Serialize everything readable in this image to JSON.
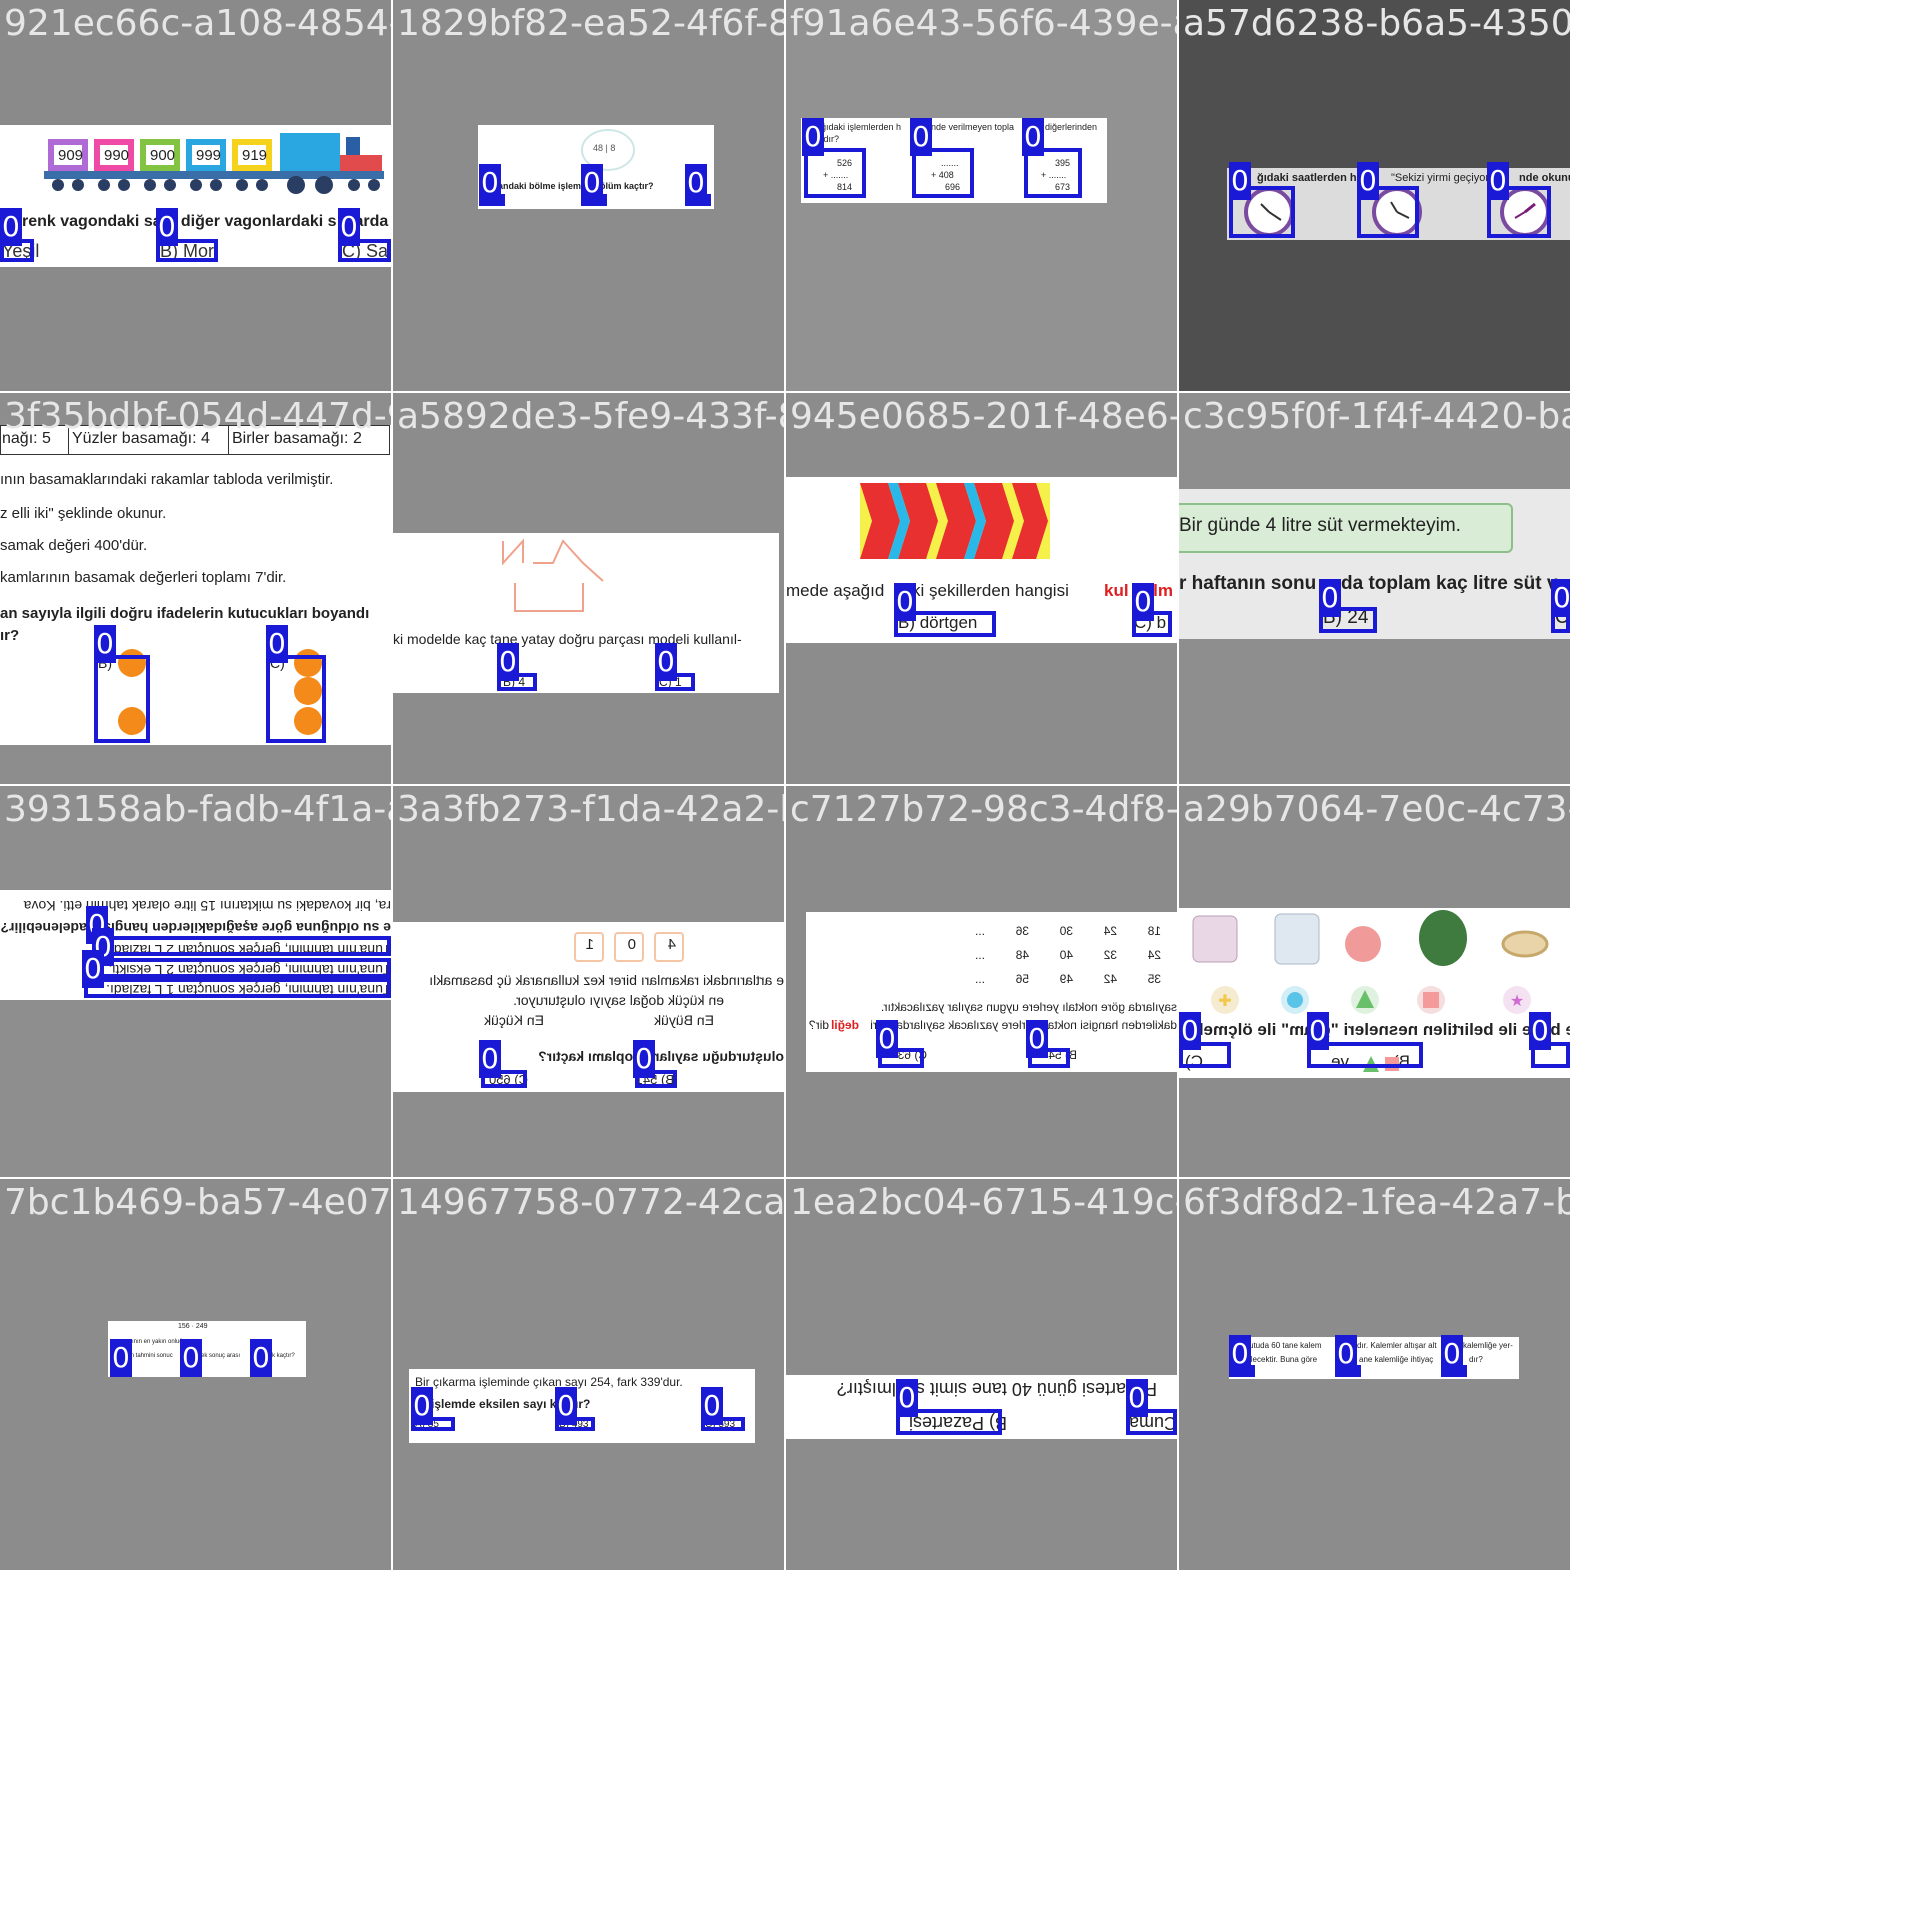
{
  "colors": {
    "title": "#e6e6e6",
    "annotation_box": "#1a1ad6",
    "annotation_label_bg": "#1a1ad6",
    "annotation_label_text": "#ffffff"
  },
  "annotation_label": "0",
  "tiles": [
    {
      "title": "921ec66c-a108-4854-8482-9ad2b8fc5a3c.jpg",
      "bg": "#8a8a8a",
      "text": {
        "q": "renk vagondaki sa",
        "q2": ", diğer vagonlardaki s",
        "q3": "larda",
        "wagons": [
          "909",
          "990",
          "900",
          "999",
          "919"
        ],
        "a": "Yeşil",
        "b": "B) Mor",
        "c": "C) Sarı"
      }
    },
    {
      "title": "1829bf82-ea52-4f6f-8214-3e791a3e4345.jpg",
      "bg": "#8c8c8c",
      "text": {
        "q": "andaki bölme işlemin",
        "q2": "ölüm kaçtır?",
        "div": "48 | 8"
      }
    },
    {
      "title": "f91a6e43-56f6-439e-ab83-3d57d0c2d65.jpg",
      "bg": "#929292",
      "text": {
        "q": "ğıdaki işlemlerden h",
        "q2": "inde verilmeyen topla",
        "q3": "diğerlerinden",
        "q4": "ıdır?",
        "a_top": "526",
        "a_plus": "+ .......",
        "a_res": "814",
        "b_top": ".......",
        "b_plus": "+ 408",
        "b_res": "696",
        "c_top": "395",
        "c_plus": "+ .......",
        "c_res": "673"
      }
    },
    {
      "title": "a57d6238-b6a5-4350-8cd5-e1.jpg",
      "bg": "#4f4f4f",
      "text": {
        "q": "ğıdaki saatlerden han",
        "q2": "\"Sekizi yirmi geçiyor.\"",
        "q3": "nde okunur?"
      }
    },
    {
      "title": "3f35bdbf-054d-447d-94fb-44158952465.jpg",
      "bg": "#8d8d8d",
      "text": {
        "c1": "nağı: 5",
        "c2": "Yüzler basamağı: 4",
        "c3": "Birler basamağı: 2",
        "l1": "ının basamaklarındaki rakamlar tabloda verilmiştir.",
        "l2": "z elli iki\" şeklinde okunur.",
        "l3": "samak değeri 400'dür.",
        "l4": "kamlarının basamak değerleri toplamı 7'dir.",
        "l5": "an sayıyla ilgili doğru ifadelerin kutucukları boyandı",
        "l6": "ır?",
        "b": "B)",
        "c": "C)"
      }
    },
    {
      "title": "a5892de3-5fe9-433f-83a6-a5fe5ad8e2c1.jpg",
      "bg": "#8c8c8c",
      "text": {
        "q": "ki modelde kaç tane yatay doğru parçası modeli kullanıl-",
        "b": "B) 4",
        "c": "C) 1"
      }
    },
    {
      "title": "945e0685-201f-48e6-b5e6-c8bd29542704.jpg",
      "bg": "#8c8c8c",
      "text": {
        "q": "mede aşağıd",
        "q2": "ki şekillerden hangisi ",
        "q3": "kul",
        "q4": "nılm",
        "b": "B) dörtgen",
        "c": "C) b"
      }
    },
    {
      "title": "c3c95f0f-1f4f-4420-ba85-c0.jpg",
      "bg": "#8e8e8e",
      "text": {
        "bubble": "Bir günde 4 litre süt vermekteyim.",
        "q": "r haftanın sonu",
        "q2": "da toplam kaç litre süt v",
        "b": "B) 24",
        "c": "C"
      }
    },
    {
      "title": "393158ab-fadb-4f1a-ae1a-e3a1cfb23e0b.jpg",
      "bg": "#8e8e8e",
      "text": {
        "q": "ra, bir kovadaki su miktarını 15 litre olarak tahmin etti. Kova",
        "q2": "e su olduğuna göre aşağıdakilerden hangisi ifadelenebilir?",
        "o1": "Tuna'nın tahmini, gerçek sonuçtan 2 L fazladı.",
        "o2": "Tuna'nın tahmini, gerçek sonuçtan 2 L eksikti.",
        "o3": "Tuna'nın tahmini, gerçek sonuçtan 1 L fazladı."
      }
    },
    {
      "title": "3a3fb273-f1da-42a2-bb3a-c7127b72985c.jpg",
      "bg": "#8d8d8d",
      "text": {
        "d1": "4",
        "d2": "0",
        "d3": "1",
        "q": "e artlarındaki rakamları birer kez kullanarak üç basamaklı",
        "q2": "en küçük doğal sayıyı oluşturuyor.",
        "l1": "En Büyük",
        "l2": "En Küçük",
        "q3": "oluşturduğu sayıların toplamı kaçtır?",
        "b": "B) 541",
        "c": "C) 650"
      }
    },
    {
      "title": "c7127b72-98c3-4df8-a626-8290766a7e2d.jpg",
      "bg": "#8b8b8b",
      "text": {
        "r1": [
          "18",
          "24",
          "30",
          "36",
          "..."
        ],
        "r2": [
          "24",
          "32",
          "40",
          "48",
          "..."
        ],
        "r3": [
          "35",
          "42",
          "49",
          "56",
          "..."
        ],
        "q": "sayılarda göre noktalı yerlere uygun sayılar yazılacaktır.",
        "q2": "dakilerden hangisi noktalı yerlere yazılacak sayılardan biri",
        "q3": "değil",
        "q4": "dir?",
        "b": "B) 54",
        "c": "C) 63"
      }
    },
    {
      "title": "a29b7064-7e0c-4c73-8230-1b.jpg",
      "bg": "#8c8c8c",
      "text": {
        "q": "se belle ile belirtilen nesneleri \"gram\" ile ölçmek o",
        "b": "B)",
        "b2": "ve",
        "c": "C)"
      }
    },
    {
      "title": "7bc1b469-ba57-4e07-a90e-d4a3e7f58de7.jpg",
      "bg": "#8c8c8c",
      "text": {
        "num": "156 · 249",
        "q": "sayısının en yakın onluğa y",
        "q2": "nin tahmini sonuc",
        "q3": "rçek sonuç arası",
        "q4": "rk kaçtır?"
      }
    },
    {
      "title": "14967758-0772-42ca-9ae5-4f5e2694f6b5.jpg",
      "bg": "#8c8c8c",
      "text": {
        "q": "Bir çıkarma işleminde çıkan sayı 254, fark 339'dur.",
        "q2": "işlemde eksilen sayı k",
        "q3": "ır?",
        "a": "A) 85",
        "b": "B) 493",
        "c": "C) 593"
      }
    },
    {
      "title": "1ea2bc04-6715-419c-9abe-7a6f30c92f5a.jpg",
      "bg": "#8c8c8c",
      "text": {
        "q": "Pazartesi günü 40 tane simit satılmıştır?",
        "b": "B) Pazartesi",
        "c": "Cuma"
      }
    },
    {
      "title": "6f3df8d2-1fea-42a7-bed5-cbf0c.jpg",
      "bg": "#8c8c8c",
      "text": {
        "q": "utuda 60 tane kalem",
        "q2": "dır. Kalemler altışar alt",
        "q3": "kalemliğe yer-",
        "q4": "ilecektir. Buna göre",
        "q5": "ane kalemliğe ihtiyaç",
        "q6": "dır?"
      }
    }
  ],
  "overlap_titles": [
    "f91a6e43-56f6-439e-ab83.jpg",
    "4db4b78a-2c9b-4a55-b0c8-c0.jpg"
  ]
}
